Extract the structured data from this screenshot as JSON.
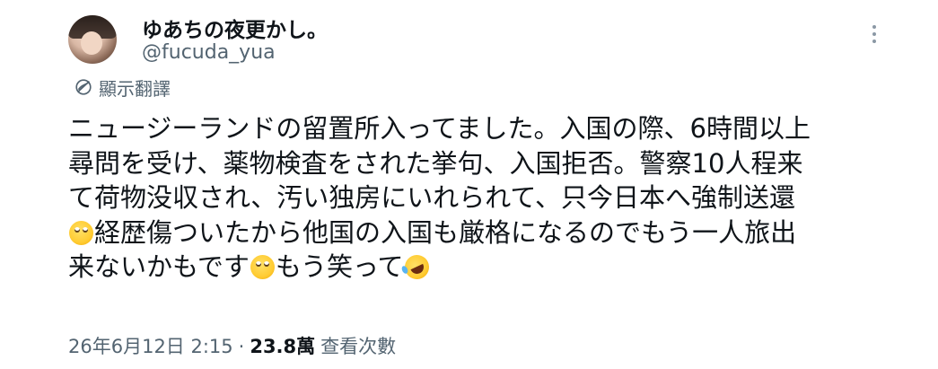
{
  "user": {
    "display_name": "ゆあちの夜更かし。",
    "handle": "@fucuda_yua"
  },
  "translate": {
    "label": "顯示翻譯",
    "icon": "translate-globe-icon"
  },
  "more": {
    "icon": "more-dots-vertical-icon"
  },
  "tweet": {
    "lines": [
      "ニュージーランドの留置所入ってました。入国の際、6時間以上",
      "尋問を受け、薬物検査をされた挙句、入国拒否。警察10人程来",
      "て荷物没収され、汚い独房にいれられて、只今日本へ強制送還",
      "経歴傷ついたから他国の入国も厳格になるのでもう一人旅出",
      "来ないかもです",
      "もう笑って"
    ],
    "emojis": [
      "face-with-rolling-eyes",
      "face-with-rolling-eyes",
      "rolling-on-the-floor-laughing"
    ]
  },
  "meta": {
    "timestamp": "26年6月12日 2:15",
    "separator": "·",
    "views_count": "23.8萬",
    "views_label": "查看次數"
  }
}
